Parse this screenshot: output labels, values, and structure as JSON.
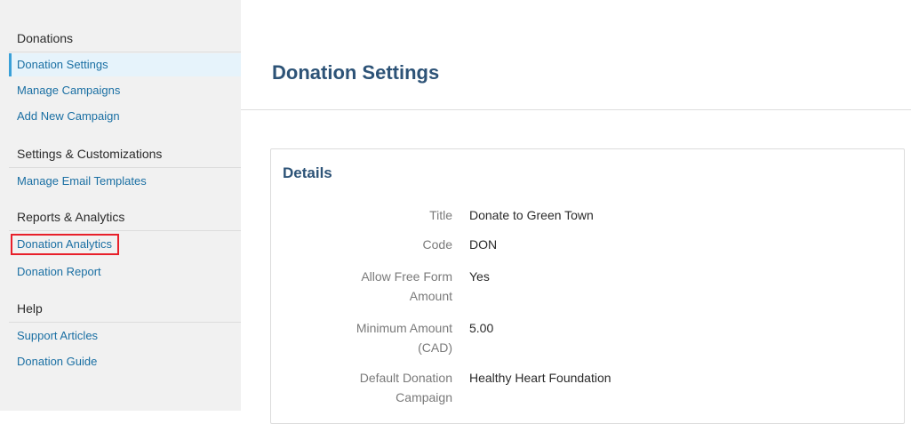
{
  "sidebar": {
    "groups": [
      {
        "heading": "Donations",
        "items": [
          {
            "label": "Donation Settings"
          },
          {
            "label": "Manage Campaigns"
          },
          {
            "label": "Add New Campaign"
          }
        ]
      },
      {
        "heading": "Settings & Customizations",
        "items": [
          {
            "label": "Manage Email Templates"
          }
        ]
      },
      {
        "heading": "Reports & Analytics",
        "items": [
          {
            "label": "Donation Analytics"
          },
          {
            "label": "Donation Report"
          }
        ]
      },
      {
        "heading": "Help",
        "items": [
          {
            "label": "Support Articles"
          },
          {
            "label": "Donation Guide"
          }
        ]
      }
    ]
  },
  "main": {
    "title": "Donation Settings",
    "details": {
      "heading": "Details",
      "fields": [
        {
          "label": "Title",
          "value": "Donate to Green Town"
        },
        {
          "label": "Code",
          "value": "DON"
        },
        {
          "label": "Allow Free Form Amount",
          "value": "Yes"
        },
        {
          "label": "Minimum Amount (CAD)",
          "value": "5.00"
        },
        {
          "label": "Default Donation Campaign",
          "value": "Healthy Heart Foundation"
        }
      ]
    }
  },
  "colors": {
    "sidebar_bg": "#f1f1f1",
    "link": "#1a6fa3",
    "heading": "#2d5377",
    "active_bg": "#e6f3fb",
    "active_bar": "#3aa0d8",
    "highlight_box": "#e8202a"
  }
}
